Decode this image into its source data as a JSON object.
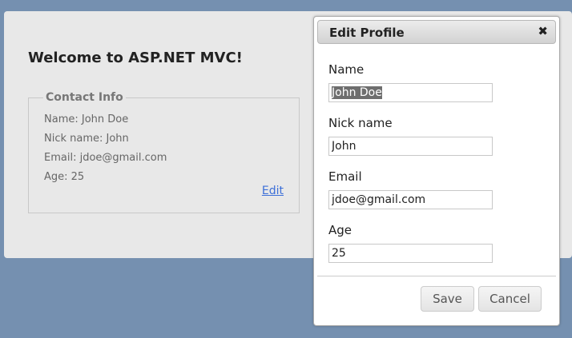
{
  "page": {
    "title": "Welcome to ASP.NET MVC!",
    "contact_info": {
      "legend": "Contact Info",
      "lines": [
        "Name: John Doe",
        "Nick name: John",
        "Email: jdoe@gmail.com",
        "Age: 25"
      ],
      "edit_link": "Edit"
    }
  },
  "dialog": {
    "title": "Edit Profile",
    "close_glyph": "✖",
    "fields": [
      {
        "label": "Name",
        "value": "John Doe"
      },
      {
        "label": "Nick name",
        "value": "John"
      },
      {
        "label": "Email",
        "value": "jdoe@gmail.com"
      },
      {
        "label": "Age",
        "value": "25"
      }
    ],
    "buttons": {
      "save": "Save",
      "cancel": "Cancel"
    }
  },
  "colors": {
    "background": "#7590b0",
    "panel": "#e8e8e8",
    "link": "#3c6fd8"
  }
}
